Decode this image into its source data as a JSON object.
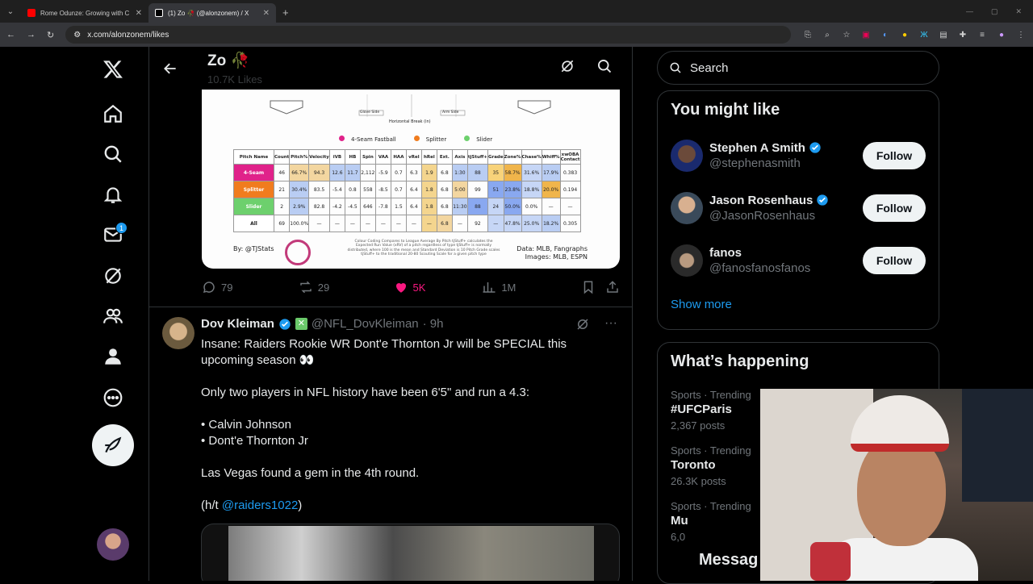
{
  "browser": {
    "tabs": [
      {
        "title": "Rome Odunze: Growing with C",
        "active": false,
        "favicon_color": "#ff0000"
      },
      {
        "title": "(1) Zo 🥀 (@alonzonem) / X",
        "active": true,
        "favicon_color": "#ffffff"
      }
    ],
    "url": "x.com/alonzonem/likes"
  },
  "nav": {
    "notifications_badge": "1"
  },
  "header": {
    "name": "Zo 🥀",
    "likes": "10.7K Likes"
  },
  "chart_image": {
    "axis_note": "Horizontal Break (in)",
    "glove_side": "Glove Side",
    "arm_side": "Arm Side",
    "legend": [
      {
        "label": "4-Seam Fastball",
        "color": "#e0228a"
      },
      {
        "label": "Splitter",
        "color": "#f07c1e"
      },
      {
        "label": "Slider",
        "color": "#6dd06d"
      }
    ],
    "columns": [
      "Pitch Name",
      "Count",
      "Pitch%",
      "Velocity",
      "iVB",
      "HB",
      "Spin",
      "VAA",
      "HAA",
      "vRel",
      "hRel",
      "Ext.",
      "Axis",
      "tjStuff+",
      "Grade",
      "Zone%",
      "Chase%",
      "Whiff%",
      "xwOBA Contact"
    ],
    "rows": [
      {
        "name": "4-Seam",
        "color": "#e0228a",
        "cells": [
          "46",
          "66.7%",
          "94.3",
          "12.6",
          "11.7",
          "2,112",
          "-5.9",
          "0.7",
          "6.3",
          "1.9",
          "6.8",
          "1:30",
          "88",
          "35",
          "58.7%",
          "31.6%",
          "17.9%",
          "0.383"
        ]
      },
      {
        "name": "Splitter",
        "color": "#f07c1e",
        "cells": [
          "21",
          "30.4%",
          "83.5",
          "-5.4",
          "0.8",
          "558",
          "-8.5",
          "0.7",
          "6.4",
          "1.8",
          "6.8",
          "5:00",
          "99",
          "51",
          "23.8%",
          "18.8%",
          "20.0%",
          "0.194"
        ]
      },
      {
        "name": "Slider",
        "color": "#6dd06d",
        "cells": [
          "2",
          "2.9%",
          "82.8",
          "-4.2",
          "-4.5",
          "646",
          "-7.8",
          "1.5",
          "6.4",
          "1.8",
          "6.8",
          "11:30",
          "88",
          "24",
          "50.0%",
          "0.0%",
          "—",
          "—"
        ]
      },
      {
        "name": "All",
        "color": "#ffffff",
        "cells": [
          "69",
          "100.0%",
          "—",
          "—",
          "—",
          "—",
          "—",
          "—",
          "—",
          "—",
          "6.8",
          "—",
          "92",
          "—",
          "47.8%",
          "25.0%",
          "18.2%",
          "0.305"
        ]
      }
    ],
    "byline": "By: @TJStats",
    "note": "Colour Coding Compares to League Average By Pitch tjStuff+ calculates the Expected Run Value (xRV) of a pitch regardless of type tjStuff+ is normally distributed, where 100 is the mean and Standard Deviation is 10 Pitch Grade scales tjStuff+ to the traditional 20-80 Scouting Scale for a given pitch type",
    "source1": "Data: MLB, Fangraphs",
    "source2": "Images: MLB, ESPN"
  },
  "tweet1_actions": {
    "replies": "79",
    "reposts": "29",
    "likes": "5K",
    "views": "1M"
  },
  "tweet2": {
    "name": "Dov Kleiman",
    "handle": "@NFL_DovKleiman",
    "time": "· 9h",
    "line1": "Insane: Raiders Rookie WR Dont'e Thornton Jr will be SPECIAL this upcoming season 👀",
    "line2": "Only two players in NFL history have been 6'5\" and run a 4.3:",
    "line3": "• Calvin Johnson",
    "line4": "• Dont'e Thornton Jr",
    "line5": "Las Vegas found a gem in the 4th round.",
    "line6_prefix": "(h/t ",
    "line6_link": "@raiders1022",
    "line6_suffix": ")"
  },
  "right": {
    "search_placeholder": "Search",
    "you_might_like": "You might like",
    "suggestions": [
      {
        "name": "Stephen A Smith",
        "handle": "@stephenasmith",
        "verified": true,
        "follow": "Follow"
      },
      {
        "name": "Jason Rosenhaus",
        "handle": "@JasonRosenhaus",
        "verified": true,
        "follow": "Follow"
      },
      {
        "name": "fanos",
        "handle": "@fanosfanosfanos",
        "verified": false,
        "follow": "Follow"
      }
    ],
    "show_more": "Show more",
    "whats_happening": "What’s happening",
    "trends": [
      {
        "context": "Sports · Trending",
        "name": "#UFCParis",
        "count": "2,367 posts"
      },
      {
        "context": "Sports · Trending",
        "name": "Toronto",
        "count": "26.3K posts"
      },
      {
        "context": "Sports · Trending",
        "name": "Mu",
        "count": "6,0"
      }
    ]
  },
  "messages_label": "Messag"
}
